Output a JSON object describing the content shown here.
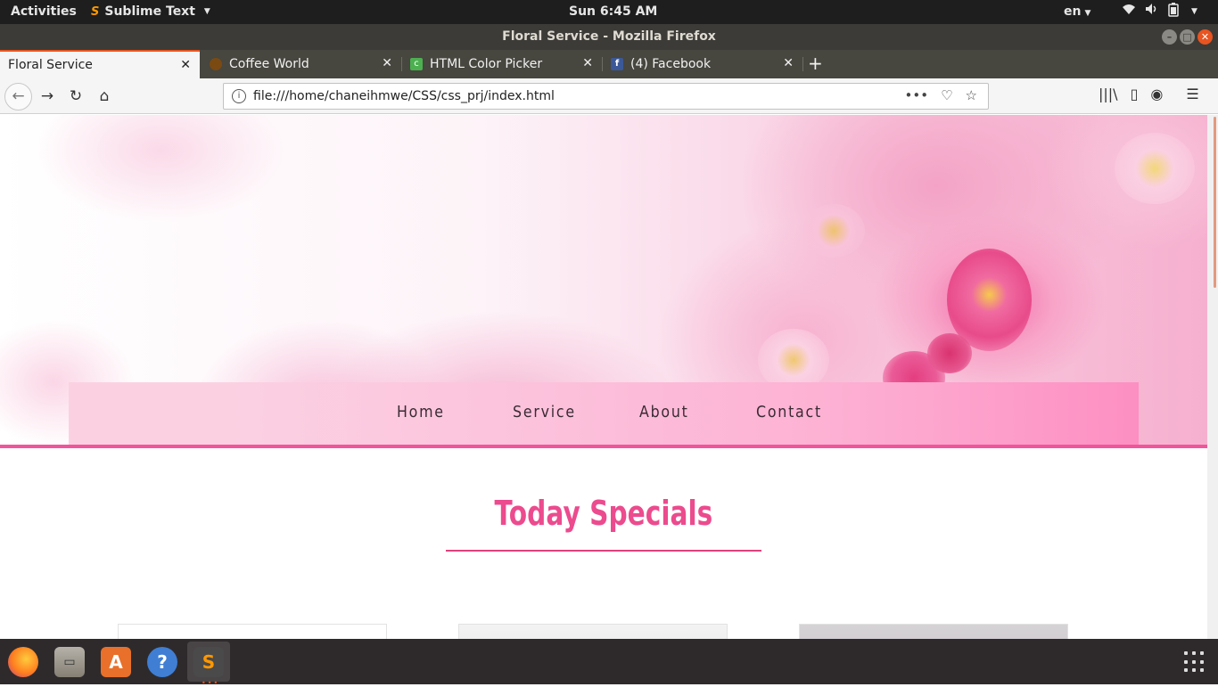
{
  "topbar": {
    "activities": "Activities",
    "app_name": "Sublime Text",
    "clock": "Sun  6:45 AM",
    "language": "en"
  },
  "window": {
    "title": "Floral Service - Mozilla Firefox"
  },
  "tabs": [
    {
      "label": "Floral Service",
      "icon": "none",
      "active": true
    },
    {
      "label": "Coffee World",
      "icon": "coffee-favicon",
      "active": false
    },
    {
      "label": "HTML Color Picker",
      "icon": "color-picker-favicon",
      "active": false
    },
    {
      "label": "(4) Facebook",
      "icon": "facebook-favicon",
      "active": false
    }
  ],
  "urlbar": {
    "url": "file:///home/chaneihmwe/CSS/css_prj/index.html"
  },
  "page": {
    "nav": [
      "Home",
      "Service",
      "About",
      "Contact"
    ],
    "specials_title": "Today Specials",
    "colors": {
      "accent_pink": "#f0559b",
      "title_pink": "#ec4b8e",
      "nav_gradient_start": "#fbd1e2",
      "nav_gradient_end": "#fd8fc2"
    }
  }
}
